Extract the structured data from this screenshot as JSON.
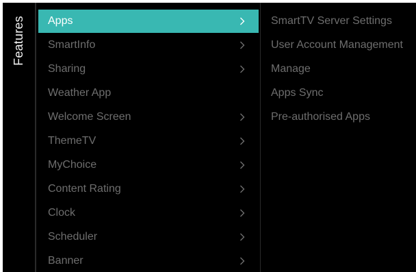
{
  "side_panel": {
    "title": "Features"
  },
  "menu": {
    "items": [
      {
        "label": "Apps",
        "has_submenu": true,
        "selected": true
      },
      {
        "label": "SmartInfo",
        "has_submenu": true,
        "selected": false
      },
      {
        "label": "Sharing",
        "has_submenu": true,
        "selected": false
      },
      {
        "label": "Weather App",
        "has_submenu": false,
        "selected": false
      },
      {
        "label": "Welcome Screen",
        "has_submenu": true,
        "selected": false
      },
      {
        "label": "ThemeTV",
        "has_submenu": true,
        "selected": false
      },
      {
        "label": "MyChoice",
        "has_submenu": true,
        "selected": false
      },
      {
        "label": "Content Rating",
        "has_submenu": true,
        "selected": false
      },
      {
        "label": "Clock",
        "has_submenu": true,
        "selected": false
      },
      {
        "label": "Scheduler",
        "has_submenu": true,
        "selected": false
      },
      {
        "label": "Banner",
        "has_submenu": true,
        "selected": false
      }
    ]
  },
  "submenu": {
    "items": [
      "SmartTV Server Settings",
      "User Account Management",
      "Manage",
      "Apps Sync",
      "Pre-authorised Apps"
    ]
  },
  "icons": {
    "submenu_indicator": "chevron-right-icon"
  },
  "colors": {
    "background": "#000000",
    "selected_bg": "#39b8b2",
    "selected_text": "#ffffff",
    "inactive_text": "#6e6e6e",
    "title_text": "#f2f2f2",
    "divider": "#2a2a2a"
  }
}
